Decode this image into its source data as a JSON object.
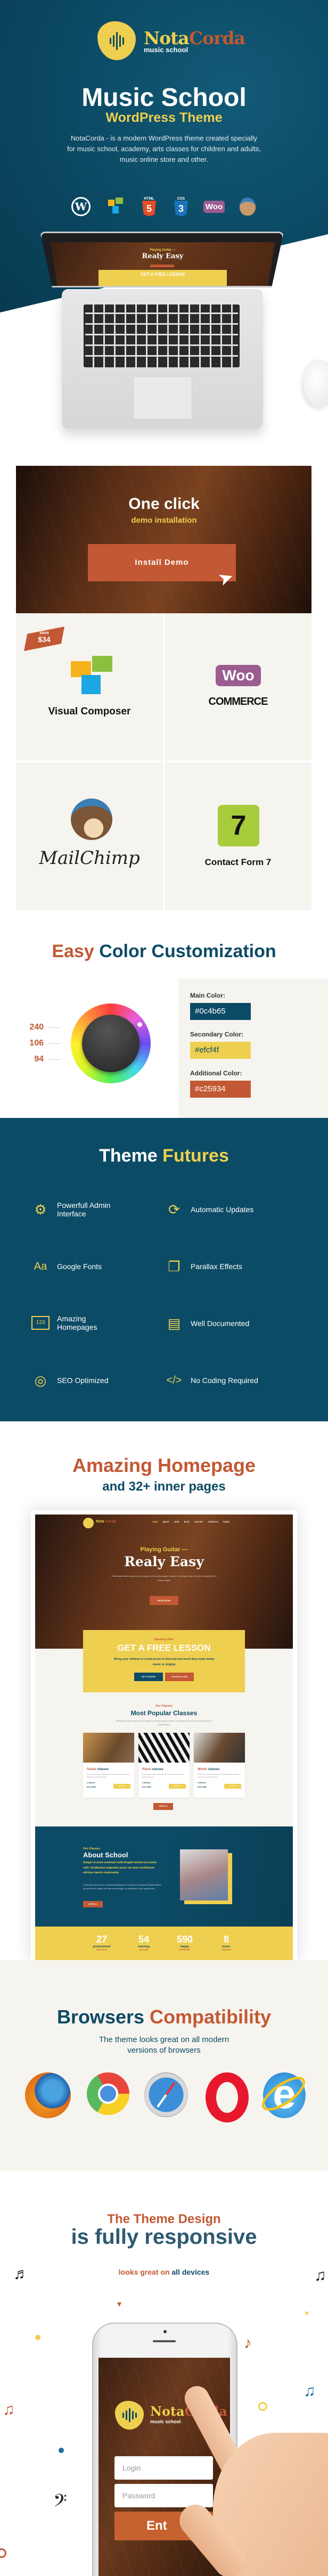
{
  "colors": {
    "main": "#0c4b65",
    "secondary": "#efcf4f",
    "additional": "#c25934",
    "cream": "#f6f4ef"
  },
  "hero": {
    "logo": {
      "part1": "Nota",
      "part2": "Corda",
      "tagline": "music school"
    },
    "title": "Music School",
    "subtitle": "WordPress Theme",
    "description": [
      "NotaCorda - is a modern WordPress theme created specially",
      "for music school, academy, arts classes for children and adults,",
      "music online store and other."
    ],
    "tech_icons": [
      "wordpress-icon",
      "visual-composer-icon",
      "html5-icon",
      "css3-icon",
      "woocommerce-icon",
      "mailchimp-icon"
    ],
    "tech_labels": {
      "html": "HTML",
      "html_num": "5",
      "css": "CSS",
      "css_num": "3",
      "woo": "Woo"
    },
    "laptop_screen": {
      "kicker": "Playing Guitar —",
      "headline": "Realy Easy",
      "offer": "GET A FREE LESSON"
    }
  },
  "demo": {
    "title": "One click",
    "subtitle": "demo installation",
    "button": "Install Demo"
  },
  "plugins": {
    "badge": {
      "top": "save",
      "amount": "$34"
    },
    "items": [
      {
        "name": "Visual Composer"
      },
      {
        "name": "WooCommerce",
        "logo_top": "Woo",
        "logo_bottom": "COMMERCE"
      },
      {
        "name": "MailChimp"
      },
      {
        "name": "Contact Form 7",
        "number": "7"
      }
    ]
  },
  "color_section": {
    "title_accent": "Easy",
    "title_rest": "Color Customization",
    "rgb": [
      "240",
      "106",
      "94"
    ],
    "swatches": [
      {
        "label": "Main Color:",
        "value": "#0c4b65"
      },
      {
        "label": "Secondary Color:",
        "value": "#efcf4f"
      },
      {
        "label": "Additional Color:",
        "value": "#c25934"
      }
    ]
  },
  "features": {
    "title_white": "Theme",
    "title_yellow": "Futures",
    "items": [
      {
        "label": "Powerfull Admin Interface",
        "icon": "gear-icon"
      },
      {
        "label": "Automatic Updates",
        "icon": "refresh-icon"
      },
      {
        "label": "Google Fonts",
        "icon": "font-icon",
        "glyph": "Aa"
      },
      {
        "label": "Parallax Effects",
        "icon": "layers-icon"
      },
      {
        "label": "Amazing Homepages",
        "icon": "browser-window-icon",
        "glyph": "123"
      },
      {
        "label": "Well Documented",
        "icon": "document-icon"
      },
      {
        "label": "SEO Optimized",
        "icon": "target-icon"
      },
      {
        "label": "No Coding Required",
        "icon": "code-icon",
        "glyph": "</>"
      }
    ]
  },
  "homepage": {
    "title": "Amazing Homepage",
    "subtitle": "and 32+ inner pages",
    "mock": {
      "logo1": "Nota",
      "logo2": "Corda",
      "nav": [
        "HOME",
        "ABOUT",
        "SHOP",
        "BLOG",
        "GALLERY",
        "CONTACTS",
        "PAGES"
      ],
      "kicker": "Playing Guitar —",
      "headline": "Realy Easy",
      "hero_text": "Pellentesque mattis mauris ac tortor volutpat, eu fermentum sapien euismod. In id tempus metus. Donec eu volutpat nibh, in maximus ligula.",
      "read_more": "READ MORE",
      "offer_kicker": "Opening Offer",
      "offer_title": "GET A FREE LESSON",
      "offer_text": "Bring your children to a trial lesson to find out how much they enjoy doing music or singing",
      "get_started": "GET STARTED",
      "choose_class": "CHOOSE CLASS",
      "classes_kicker": "Our Classes",
      "classes_title": "Most Popular Classes",
      "classes_text": "Pellentesque mattis mauris ac tortor volutpat, eu fermentum sapien euismod. In id tempus metus. Donec eu volutpat nibh, in maximus ligula.",
      "cards": [
        {
          "accent": "Guitar",
          "rest": "classes",
          "text": "Nunc rhoncus libero vitae urna commodo faucibus. Mauris at feugiat est, sit amet gravida.",
          "duration": "3 months",
          "price": "from 300$",
          "button": "more info"
        },
        {
          "accent": "Piano",
          "rest": "classes",
          "text": "Pellentesque mattis mauris ac tortor volutpat, eu fermentum sapien euismod.",
          "duration": "3 months",
          "price": "from 300$",
          "button": "more info"
        },
        {
          "accent": "Winds",
          "rest": "classes",
          "text": "Nunc rhoncus libero vitae urna commodo faucibus. Mauris at feugiat est, sit amet gravida.",
          "duration": "3 months",
          "price": "from 300$",
          "button": "more info"
        }
      ],
      "view_all": "VIEW ALL",
      "about_kicker": "Our Classes",
      "about_title": "About School",
      "about_lead": "Integer in justo euismod nulla feugiat lacinia non porta velit. Vestibulum vulputate purus sit amet vestibulum ultrices mauris malesuada.",
      "about_text": "Lorem ipsum dolor sit amet, consectetur adipiscing elit. Ut elementum sem ligula. Phasellus eleifend vel justo sit amet volutpat. Duis vitae maximus ligula, nec mattis libero. Donec eget felis odio.",
      "about_button": "VIEW ALL",
      "stats": [
        {
          "value": "27",
          "line1": "professional",
          "line2": "teachers"
        },
        {
          "value": "54",
          "line1": "learning",
          "line2": "groups"
        },
        {
          "value": "590",
          "line1": "happy",
          "line2": "students"
        },
        {
          "value": "8",
          "line1": "music",
          "line2": "classes"
        }
      ]
    }
  },
  "browsers": {
    "title_blue": "Browsers",
    "title_orange": "Compatibility",
    "subtitle": [
      "The theme looks great on all modern",
      "versions of browsers"
    ],
    "icons": [
      "firefox-icon",
      "chrome-icon",
      "safari-icon",
      "opera-icon",
      "internet-explorer-icon"
    ]
  },
  "responsive": {
    "title1": "The Theme Design",
    "title2": "is fully responsive",
    "tag_orange": "looks great on",
    "tag_blue": "all devices",
    "phone": {
      "logo1": "Nota",
      "logo2": "Corda",
      "tagline": "music school",
      "login_placeholder": "Login",
      "password_placeholder": "Password",
      "enter": "Ent"
    }
  }
}
